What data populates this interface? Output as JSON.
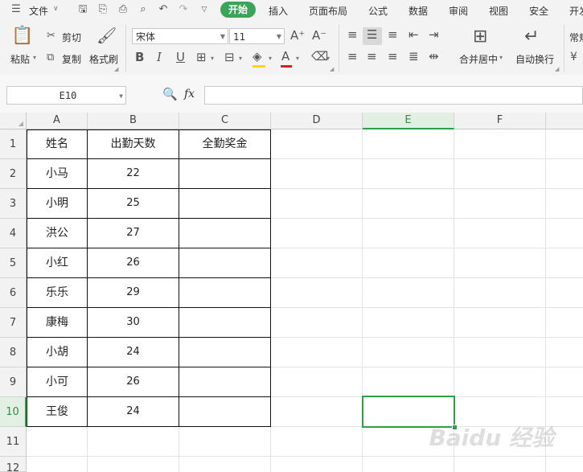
{
  "menu": {
    "file_label": "文件",
    "tabs": [
      "开始",
      "插入",
      "页面布局",
      "公式",
      "数据",
      "审阅",
      "视图",
      "安全",
      "开发"
    ],
    "active_tab": "开始"
  },
  "ribbon": {
    "paste": "粘贴",
    "cut": "剪切",
    "copy": "复制",
    "format_painter": "格式刷",
    "font_name": "宋体",
    "font_size": "11",
    "merge_center": "合并居中",
    "wrap_text": "自动换行",
    "number_format": "常规",
    "font_color": "#e02020",
    "fill_color": "#ffd800"
  },
  "formula_bar": {
    "name_box": "E10",
    "fx": "fx",
    "formula": ""
  },
  "sheet": {
    "columns": [
      "A",
      "B",
      "C",
      "D",
      "E",
      "F"
    ],
    "rows": [
      "1",
      "2",
      "3",
      "4",
      "5",
      "6",
      "7",
      "8",
      "9",
      "10",
      "11",
      "12"
    ],
    "selected_cell": "E10",
    "header": [
      "姓名",
      "出勤天数",
      "全勤奖金"
    ],
    "data": [
      [
        "小马",
        "22",
        ""
      ],
      [
        "小明",
        "25",
        ""
      ],
      [
        "洪公",
        "27",
        ""
      ],
      [
        "小红",
        "26",
        ""
      ],
      [
        "乐乐",
        "29",
        ""
      ],
      [
        "康梅",
        "30",
        ""
      ],
      [
        "小胡",
        "24",
        ""
      ],
      [
        "小可",
        "26",
        ""
      ],
      [
        "王俊",
        "24",
        ""
      ]
    ]
  },
  "watermark": "Baidu 经验"
}
